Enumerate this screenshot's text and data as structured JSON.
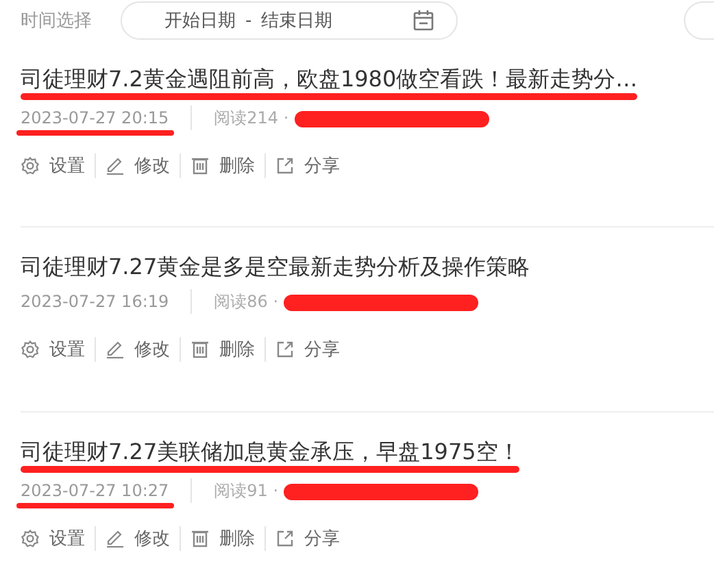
{
  "filter": {
    "label": "时间选择",
    "start_placeholder": "开始日期",
    "separator": "-",
    "end_placeholder": "结束日期"
  },
  "posts": [
    {
      "title": "司徒理财7.2黄金遇阻前高，欧盘1980做空看跌！最新走势分…",
      "time": "2023-07-27 20:15",
      "reads": "阅读214 ·",
      "underlined": true,
      "redacted": true,
      "actions": [
        "设置",
        "修改",
        "删除",
        "分享"
      ]
    },
    {
      "title": "司徒理财7.27黄金是多是空最新走势分析及操作策略",
      "time": "2023-07-27 16:19",
      "reads": "阅读86 ·",
      "underlined": false,
      "redacted": true,
      "actions": [
        "设置",
        "修改",
        "删除",
        "分享"
      ]
    },
    {
      "title": "司徒理财7.27美联储加息黄金承压，早盘1975空！",
      "time": "2023-07-27 10:27",
      "reads": "阅读91 ·",
      "underlined": true,
      "redacted": true,
      "actions": [
        "设置",
        "修改",
        "删除",
        "分享"
      ]
    }
  ]
}
